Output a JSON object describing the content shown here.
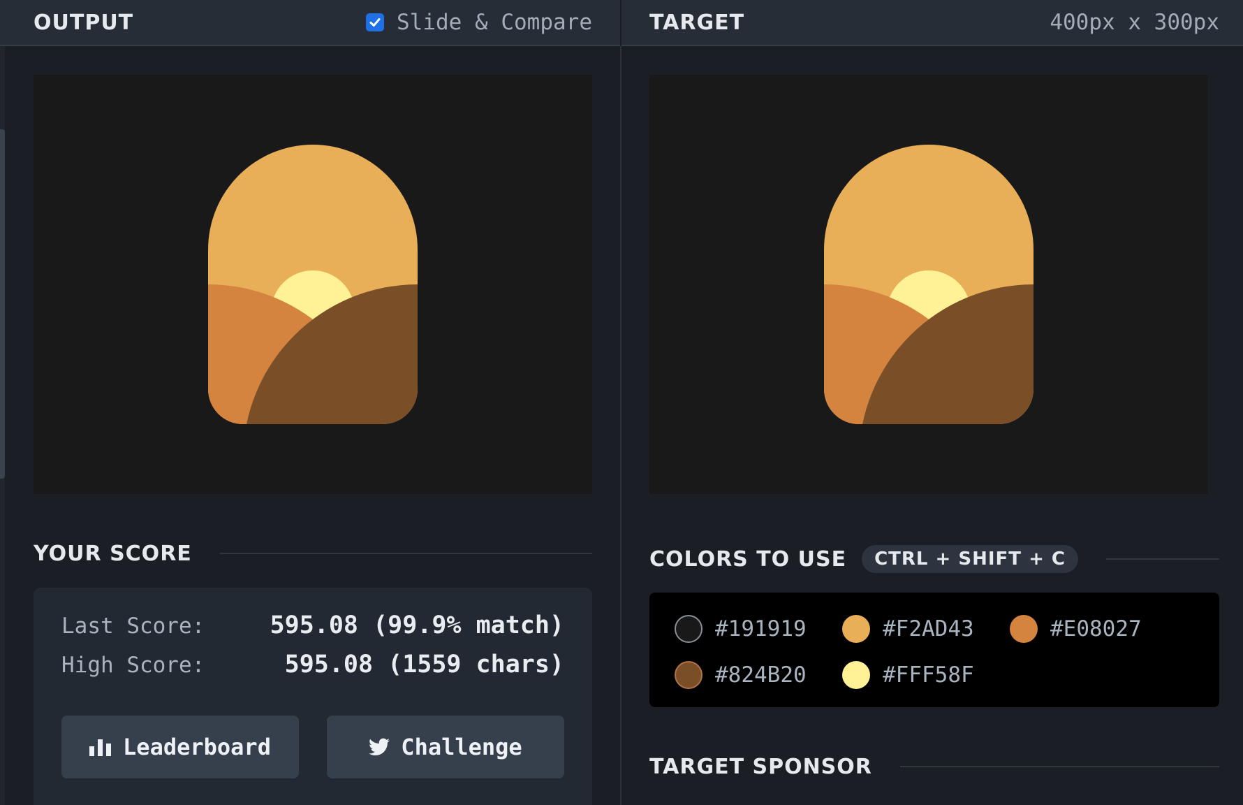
{
  "output_header": {
    "title": "OUTPUT",
    "compare_checked": true,
    "compare_label": "Slide & Compare"
  },
  "target_header": {
    "title": "TARGET",
    "dimensions": "400px x 300px"
  },
  "score": {
    "section_title": "YOUR SCORE",
    "last_label": "Last Score:",
    "last_value": "595.08 (99.9% match)",
    "high_label": "High Score:",
    "high_value": "595.08 (1559 chars)",
    "leaderboard_label": "Leaderboard",
    "challenge_label": "Challenge"
  },
  "colors": {
    "section_title": "COLORS TO USE",
    "shortcut": "CTRL + SHIFT + C",
    "items": [
      {
        "hex": "#191919",
        "swatch": "#191919"
      },
      {
        "hex": "#F2AD43",
        "swatch": "#E8AE58"
      },
      {
        "hex": "#E08027",
        "swatch": "#D4843E"
      },
      {
        "hex": "#824B20",
        "swatch": "#7A4F28"
      },
      {
        "hex": "#FFF58F",
        "swatch": "#FFF195"
      }
    ]
  },
  "sponsor": {
    "section_title": "TARGET SPONSOR"
  },
  "palette": {
    "background": "#191919",
    "arch": "#E8AE58",
    "sun": "#FFF195",
    "left_hill": "#D4843E",
    "right_hill": "#7A4F28"
  },
  "icons": {
    "checkbox": "checkmark-icon",
    "leaderboard": "bar-chart-icon",
    "challenge": "twitter-bird-icon"
  }
}
